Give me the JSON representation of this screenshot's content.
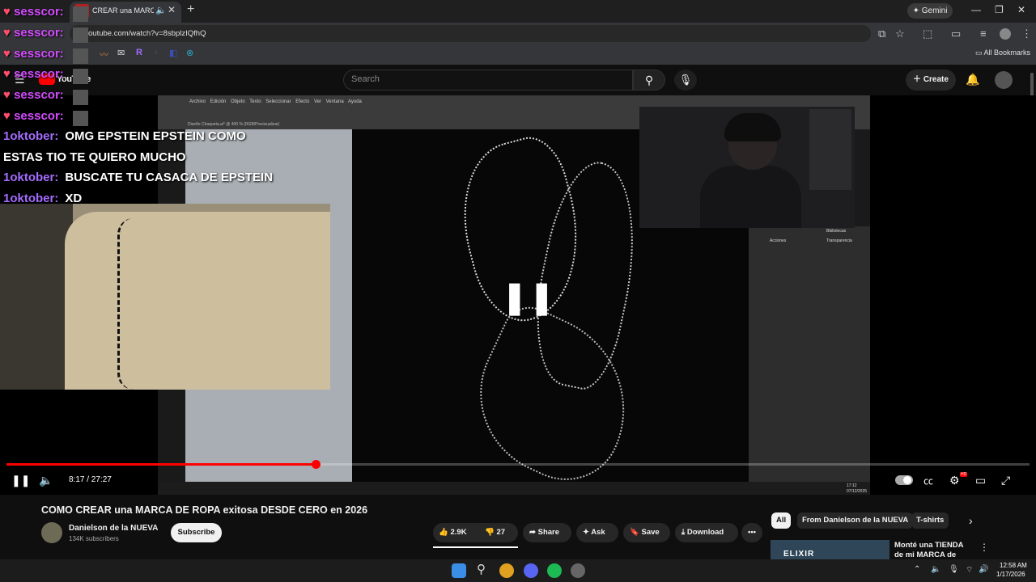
{
  "browser": {
    "tab_title": "CREAR una MARCA",
    "url": "outube.com/watch?v=8sbplzIQfhQ",
    "gemini_label": "Gemini",
    "all_bookmarks": "All Bookmarks"
  },
  "youtube": {
    "logo_text": "YouTube",
    "search_placeholder": "Search",
    "create_label": "Create"
  },
  "chat": [
    {
      "user": "sesscor:",
      "text": ""
    },
    {
      "user": "sesscor:",
      "text": ""
    },
    {
      "user": "sesscor:",
      "text": ""
    },
    {
      "user": "sesscor:",
      "text": ""
    },
    {
      "user": "sesscor:",
      "text": ""
    },
    {
      "user": "sesscor:",
      "text": ""
    },
    {
      "user": "1oktober:",
      "text": "OMG EPSTEIN EPSTEIN COMO"
    },
    {
      "user": "",
      "text": "ESTAS TIO TE QUIERO MUCHO"
    },
    {
      "user": "1oktober:",
      "text": "BUSCATE TU CASACA DE EPSTEIN"
    },
    {
      "user": "1oktober:",
      "text": "XD"
    }
  ],
  "illustrator": {
    "menu": "Archivo Edición Objeto Texto Seleccionar Efecto Ver Ventana Ayuda",
    "doc_title": "Diseño Chaqueta.ai* @ 400 % (RGB/Previsualizar)",
    "panel_items": [
      "Bibliotecas",
      "Acciones",
      "Transparencia"
    ],
    "clock_time": "17:12",
    "clock_date": "07/12/2025"
  },
  "player": {
    "current_time": "8:17",
    "duration": "27:27",
    "time_display": "8:17 / 27:27",
    "progress": 0.302
  },
  "video": {
    "title": "COMO CREAR una MARCA DE ROPA exitosa DESDE CERO en 2026",
    "channel": "Danielson de la NUEVA",
    "subscribers": "134K subscribers",
    "subscribe_label": "Subscribe",
    "likes": "2.9K",
    "dislikes": "27",
    "share_label": "Share",
    "ask_label": "Ask",
    "save_label": "Save",
    "download_label": "Download"
  },
  "chips": [
    "All",
    "From Danielson de la NUEVA",
    "T-shirts"
  ],
  "recommendation": {
    "thumb_text": "ELIXIR",
    "title": "Monté una TIENDA de mi MARCA de ROPA y"
  },
  "taskbar": {
    "time": "12:58 AM",
    "date": "1/17/2026"
  },
  "colors": {
    "accent": "#ff0000",
    "chat_user": "#a46cff",
    "heart": "#ff4d6d"
  }
}
